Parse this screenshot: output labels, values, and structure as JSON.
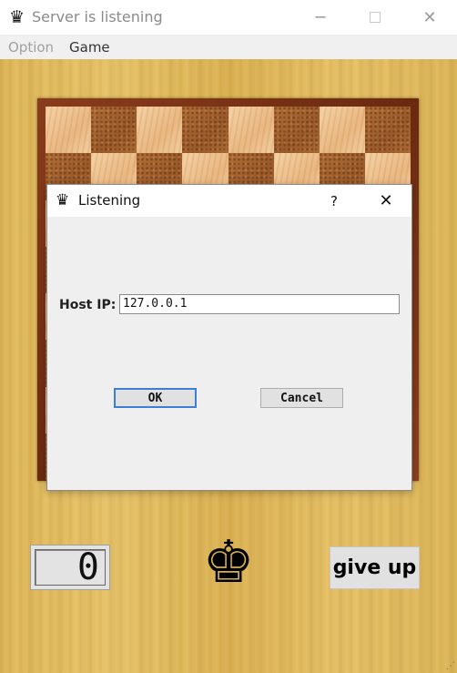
{
  "window": {
    "title": "Server is listening",
    "app_icon": "queen-icon",
    "minimize_icon": "minimize-icon",
    "maximize_icon": "maximize-icon",
    "close_icon": "close-icon"
  },
  "menu": {
    "items": [
      {
        "label": "Option",
        "enabled": false
      },
      {
        "label": "Game",
        "enabled": true
      }
    ]
  },
  "dialog": {
    "title": "Listening",
    "help_label": "?",
    "host_label": "Host IP:",
    "host_value": "127.0.0.1",
    "ok_label": "OK",
    "cancel_label": "Cancel"
  },
  "status": {
    "counter_value": "0",
    "player_piece": "king-icon",
    "king_glyph": "♚",
    "give_up_label": "give up"
  },
  "colors": {
    "wood": "#e0b85a",
    "board_frame": "#7a3418",
    "light_square": "#f0c894",
    "dark_square": "#a86830",
    "ok_focus_border": "#3b7fd4"
  }
}
